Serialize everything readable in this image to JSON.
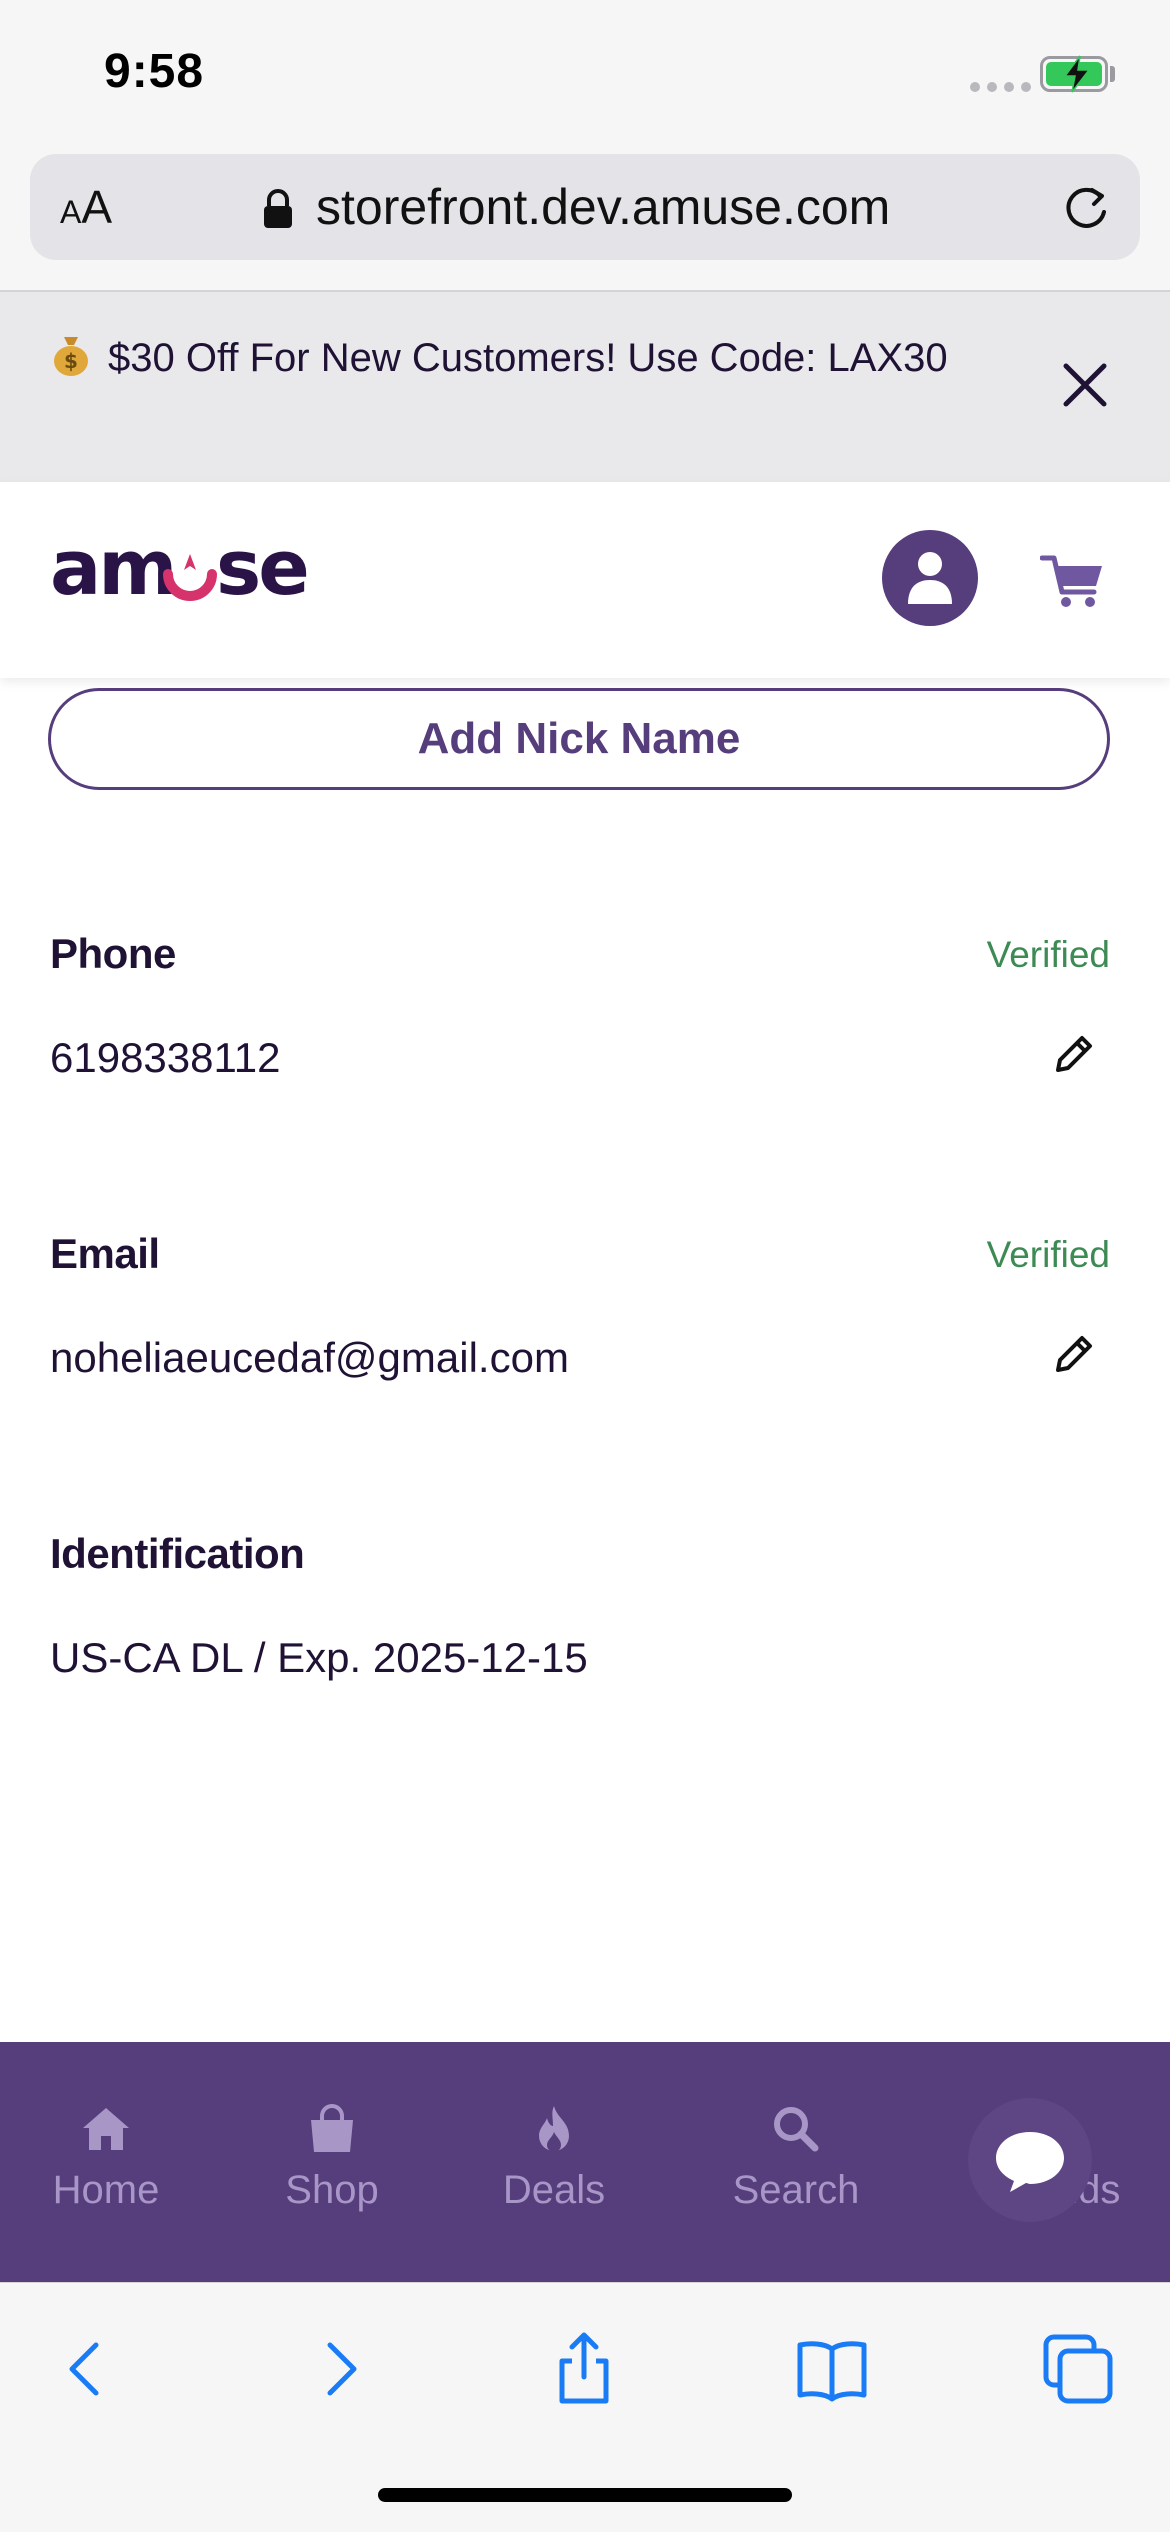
{
  "status_bar": {
    "time": "9:58"
  },
  "browser": {
    "text_size_label": "AA",
    "url": "storefront.dev.amuse.com"
  },
  "promo": {
    "message": "$30 Off For New Customers! Use Code: LAX30"
  },
  "header": {
    "brand": "amuse"
  },
  "profile": {
    "nickname_button": "Add Nick Name",
    "phone": {
      "label": "Phone",
      "status": "Verified",
      "value": "6198338112"
    },
    "email": {
      "label": "Email",
      "status": "Verified",
      "value": "noheliaeucedaf@gmail.com"
    },
    "identification": {
      "label": "Identification",
      "value": "US-CA DL / Exp. 2025-12-15"
    }
  },
  "bottom_nav": {
    "items": [
      {
        "label": "Home",
        "icon": "home-icon"
      },
      {
        "label": "Shop",
        "icon": "shopping-bag-icon"
      },
      {
        "label": "Deals",
        "icon": "flame-icon"
      },
      {
        "label": "Search",
        "icon": "search-icon"
      },
      {
        "label": "Brands",
        "icon": "chat-bubble-icon"
      }
    ]
  },
  "colors": {
    "brand_purple": "#563d7c",
    "verified_green": "#3d8a54",
    "logo_accent": "#d6336c",
    "ios_blue": "#1a7cf5"
  }
}
